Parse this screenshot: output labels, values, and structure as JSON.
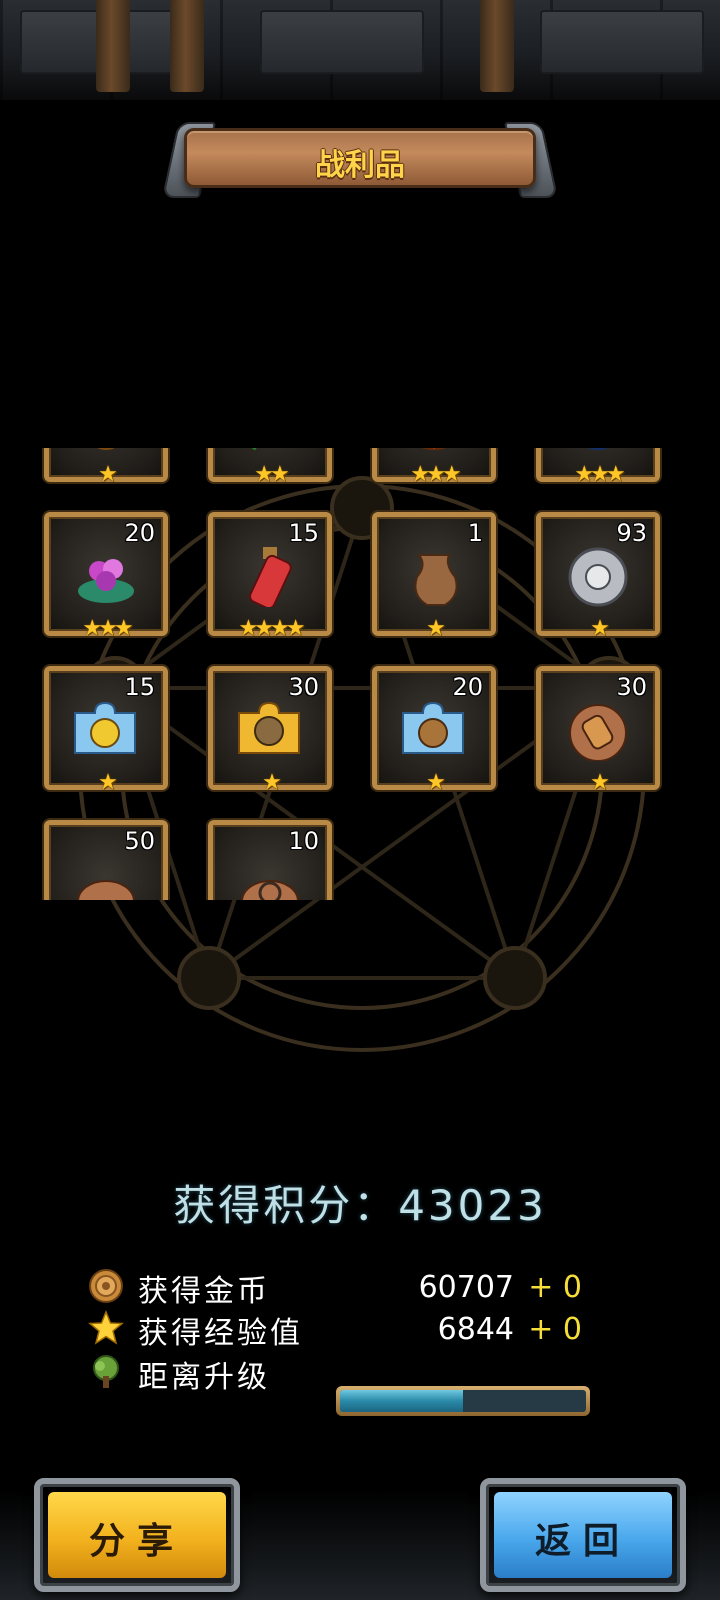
{
  "title": "战利品",
  "grid": {
    "rows": [
      [
        {
          "name": "golden-pear",
          "count": "",
          "stars": "★"
        },
        {
          "name": "green-herb",
          "count": "",
          "stars": "★★"
        },
        {
          "name": "pumpkin",
          "count": "",
          "stars": "★★★"
        },
        {
          "name": "blue-orb",
          "count": "",
          "stars": "★★★"
        }
      ],
      [
        {
          "name": "purple-flower",
          "count": "20",
          "stars": "★★★"
        },
        {
          "name": "red-potion",
          "count": "15",
          "stars": "★★★★"
        },
        {
          "name": "clay-urn",
          "count": "1",
          "stars": "★"
        },
        {
          "name": "silver-coin",
          "count": "93",
          "stars": "★"
        }
      ],
      [
        {
          "name": "blue-puzzle-piece",
          "count": "15",
          "stars": "★"
        },
        {
          "name": "gold-puzzle-piece",
          "count": "30",
          "stars": "★"
        },
        {
          "name": "blue-puzzle-piece-2",
          "count": "20",
          "stars": "★"
        },
        {
          "name": "gauntlet-token",
          "count": "30",
          "stars": "★"
        }
      ],
      [
        {
          "name": "bowl-token",
          "count": "50",
          "stars": ""
        },
        {
          "name": "ring-token",
          "count": "10",
          "stars": ""
        }
      ]
    ]
  },
  "score": {
    "label": "获得积分：43023"
  },
  "stats": {
    "gold": {
      "label": "获得金币",
      "value": "60707",
      "bonus": "+ 0"
    },
    "exp": {
      "label": "获得经验值",
      "value": "6844",
      "bonus": "+ 0"
    },
    "level": {
      "label": "距离升级",
      "progress": 0.5
    }
  },
  "buttons": {
    "share": "分享",
    "back": "返回"
  },
  "colors": {
    "star": "#ffc628",
    "bonus": "#f5dd3a",
    "score": "#bfe0e6"
  }
}
